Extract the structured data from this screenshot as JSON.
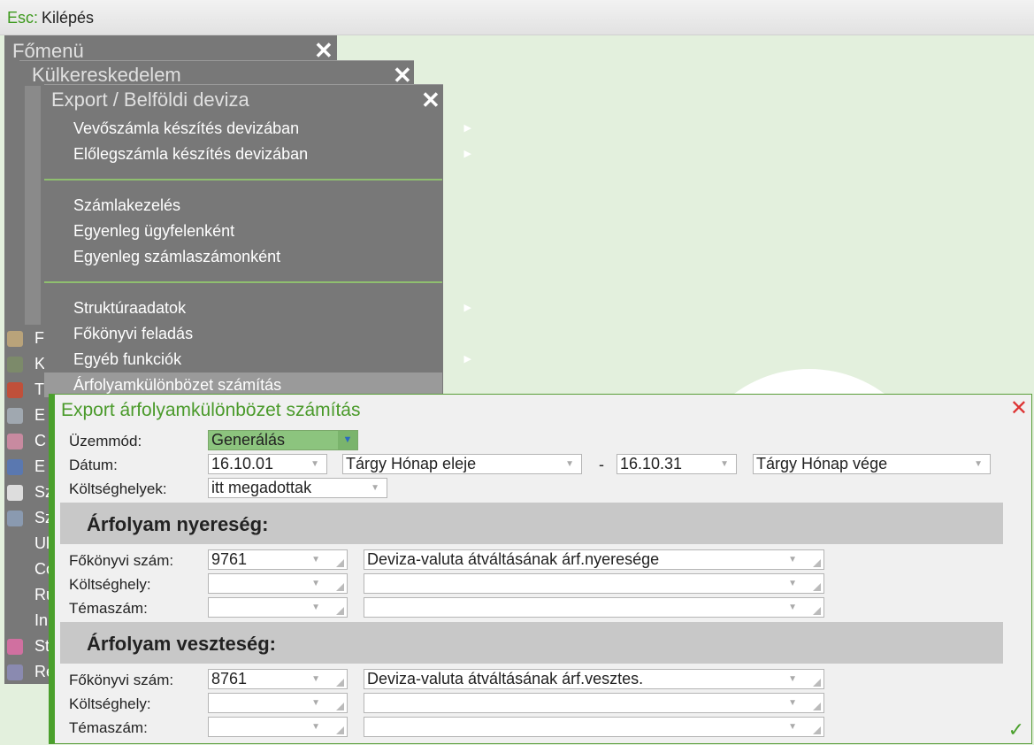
{
  "topbar": {
    "key": "Esc:",
    "label": "Kilépés"
  },
  "main_menu": {
    "title": "Főmenü",
    "items": [
      "F",
      "K",
      "T",
      "E",
      "C",
      "E",
      "Sz",
      "Sz",
      "Ul",
      "Co",
      "Ru",
      "In",
      "St",
      "Re"
    ]
  },
  "foreign_trade_menu": {
    "title": "Külkereskedelem"
  },
  "export_menu": {
    "title": "Export / Belföldi deviza",
    "items": [
      {
        "label": "Vevőszámla készítés devizában",
        "submenu": true
      },
      {
        "label": "Előlegszámla készítés devizában",
        "submenu": true
      },
      {
        "label": "Számlakezelés",
        "submenu": false
      },
      {
        "label": "Egyenleg ügyfelenként",
        "submenu": false
      },
      {
        "label": "Egyenleg számlaszámonként",
        "submenu": false
      },
      {
        "label": "Struktúraadatok",
        "submenu": true
      },
      {
        "label": "Főkönyvi feladás",
        "submenu": false
      },
      {
        "label": "Egyéb funkciók",
        "submenu": true
      },
      {
        "label": "Árfolyamkülönbözet számítás",
        "submenu": false,
        "selected": true
      }
    ]
  },
  "dialog": {
    "title": "Export árfolyamkülönbözet számítás",
    "mode_label": "Üzemmód:",
    "mode_value": "Generálás",
    "date_label": "Dátum:",
    "date_from": "16.10.01",
    "date_from_type": "Tárgy Hónap eleje",
    "date_sep": "-",
    "date_to": "16.10.31",
    "date_to_type": "Tárgy Hónap vége",
    "cost_centers_label": "Költséghelyek:",
    "cost_centers_value": "itt megadottak",
    "gain": {
      "title": "Árfolyam nyereség:",
      "ledger_label": "Főkönyvi szám:",
      "ledger_value": "9761",
      "ledger_name": "Deviza-valuta átváltásának árf.nyeresége",
      "cost_center_label": "Költséghely:",
      "cost_center_value": "",
      "cost_center_name": "",
      "topic_label": "Témaszám:",
      "topic_value": "",
      "topic_name": ""
    },
    "loss": {
      "title": "Árfolyam veszteség:",
      "ledger_label": "Főkönyvi szám:",
      "ledger_value": "8761",
      "ledger_name": "Deviza-valuta átváltásának árf.vesztes.",
      "cost_center_label": "Költséghely:",
      "cost_center_value": "",
      "cost_center_name": "",
      "topic_label": "Témaszám:",
      "topic_value": "",
      "topic_name": ""
    }
  },
  "colors": {
    "accent": "#4aa02c",
    "menu_bg": "#787878",
    "mode_select": "#8cc47e",
    "close_red": "#dd3333"
  }
}
